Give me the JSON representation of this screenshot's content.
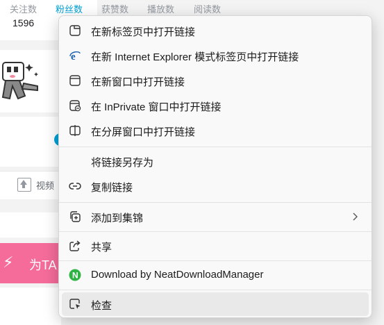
{
  "background": {
    "stats_labels": [
      "关注数",
      "粉丝数",
      "获赞数",
      "播放数",
      "阅读数"
    ],
    "stats_active_index": 1,
    "following_count": "1596",
    "upload_label": "视频",
    "banner_text": "为TA",
    "banner_color": "#f56c9a",
    "accent_color": "#00a1d6"
  },
  "context_menu": {
    "items": [
      {
        "label": "在新标签页中打开链接",
        "icon": "new-tab-icon"
      },
      {
        "label": "在新 Internet Explorer 模式标签页中打开链接",
        "icon": "internet-explorer-icon"
      },
      {
        "label": "在新窗口中打开链接",
        "icon": "new-window-icon"
      },
      {
        "label": "在 InPrivate 窗口中打开链接",
        "icon": "inprivate-window-icon"
      },
      {
        "label": "在分屏窗口中打开链接",
        "icon": "split-screen-icon"
      },
      {
        "label": "将链接另存为",
        "icon": ""
      },
      {
        "label": "复制链接",
        "icon": "link-icon"
      },
      {
        "label": "添加到集锦",
        "icon": "collections-icon",
        "has_submenu": true
      },
      {
        "label": "共享",
        "icon": "share-icon"
      },
      {
        "label": "Download by NeatDownloadManager",
        "icon": "neat-download-manager-icon"
      },
      {
        "label": "检查",
        "icon": "inspect-icon",
        "hovered": true
      }
    ],
    "ndm_icon_color": "#2fb344",
    "ndm_icon_letter": "N"
  }
}
